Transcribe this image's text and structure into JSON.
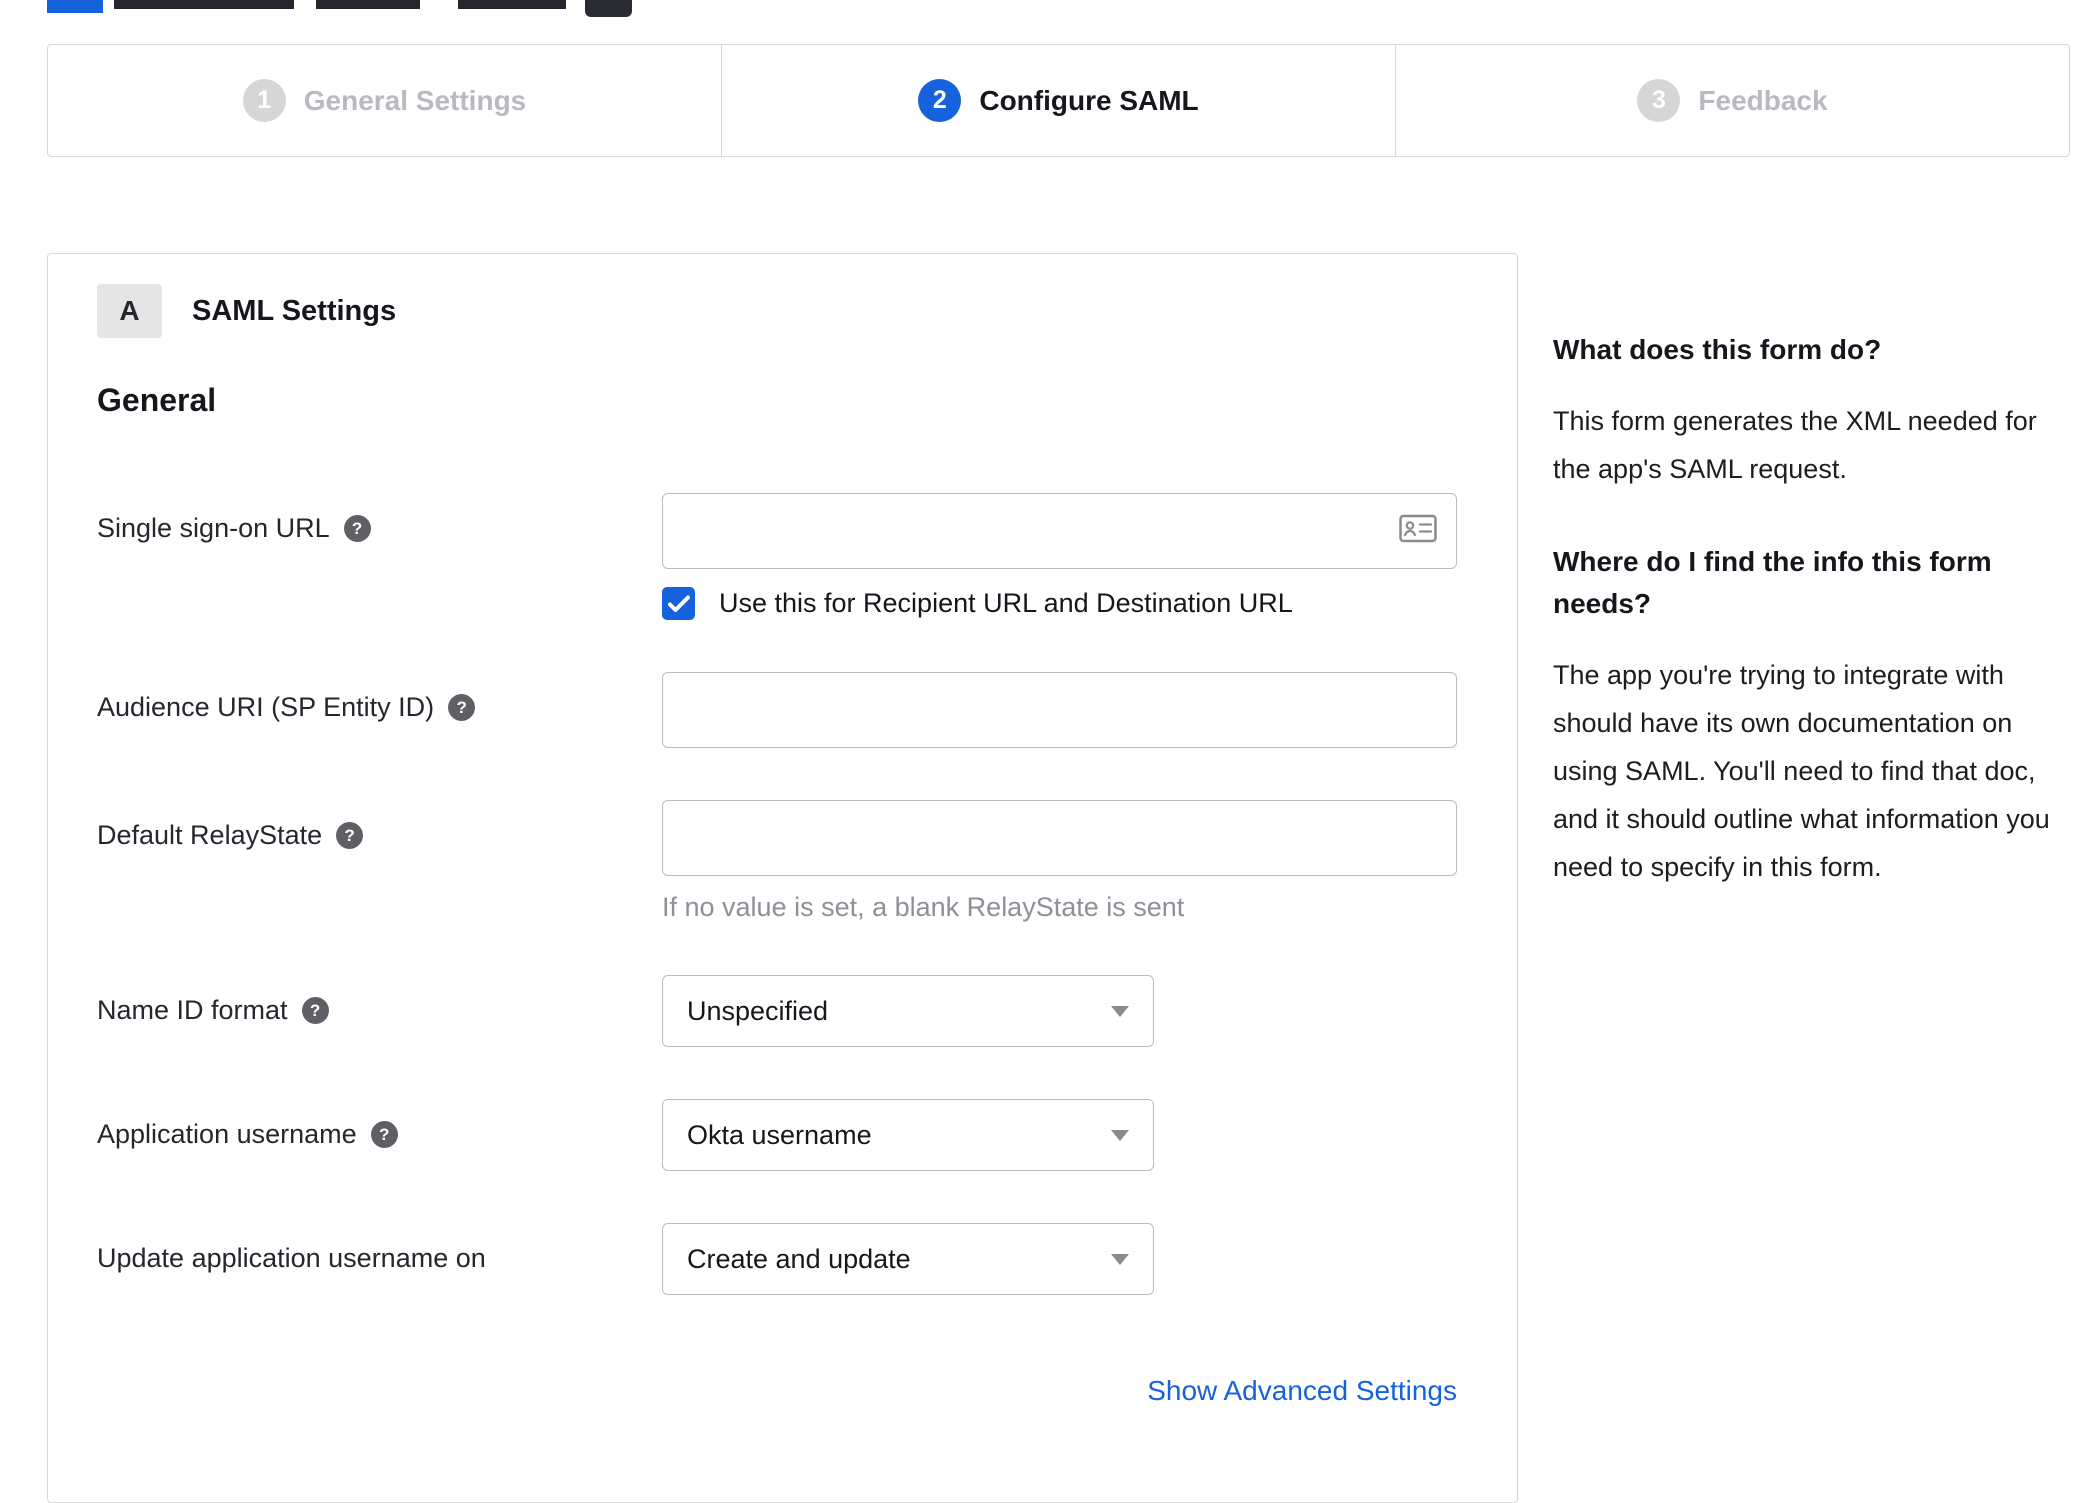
{
  "stepper": {
    "steps": [
      {
        "number": "1",
        "label": "General Settings"
      },
      {
        "number": "2",
        "label": "Configure SAML"
      },
      {
        "number": "3",
        "label": "Feedback"
      }
    ],
    "active_index": 1
  },
  "form": {
    "section_badge": "A",
    "section_title": "SAML Settings",
    "group_title": "General",
    "fields": {
      "sso_url": {
        "label": "Single sign-on URL",
        "value": "",
        "checkbox_label": "Use this for Recipient URL and Destination URL",
        "checkbox_checked": true
      },
      "audience_uri": {
        "label": "Audience URI (SP Entity ID)",
        "value": ""
      },
      "relay_state": {
        "label": "Default RelayState",
        "value": "",
        "helper": "If no value is set, a blank RelayState is sent"
      },
      "name_id_format": {
        "label": "Name ID format",
        "value": "Unspecified"
      },
      "app_username": {
        "label": "Application username",
        "value": "Okta username"
      },
      "update_username": {
        "label": "Update application username on",
        "value": "Create and update"
      }
    },
    "advanced_link": "Show Advanced Settings"
  },
  "sidebar": {
    "sections": [
      {
        "heading": "What does this form do?",
        "body": "This form generates the XML needed for the app's SAML request."
      },
      {
        "heading": "Where do I find the info this form needs?",
        "body": "The app you're trying to integrate with should have its own documentation on using SAML. You'll need to find that doc, and it should outline what information you need to specify in this form."
      }
    ]
  },
  "icons": {
    "help": "?"
  },
  "colors": {
    "accent": "#1662dd",
    "inactive_step": "#d6d6d6",
    "border": "#d8d8d8",
    "link": "#1662dd",
    "helper_text": "#8f8f99"
  }
}
